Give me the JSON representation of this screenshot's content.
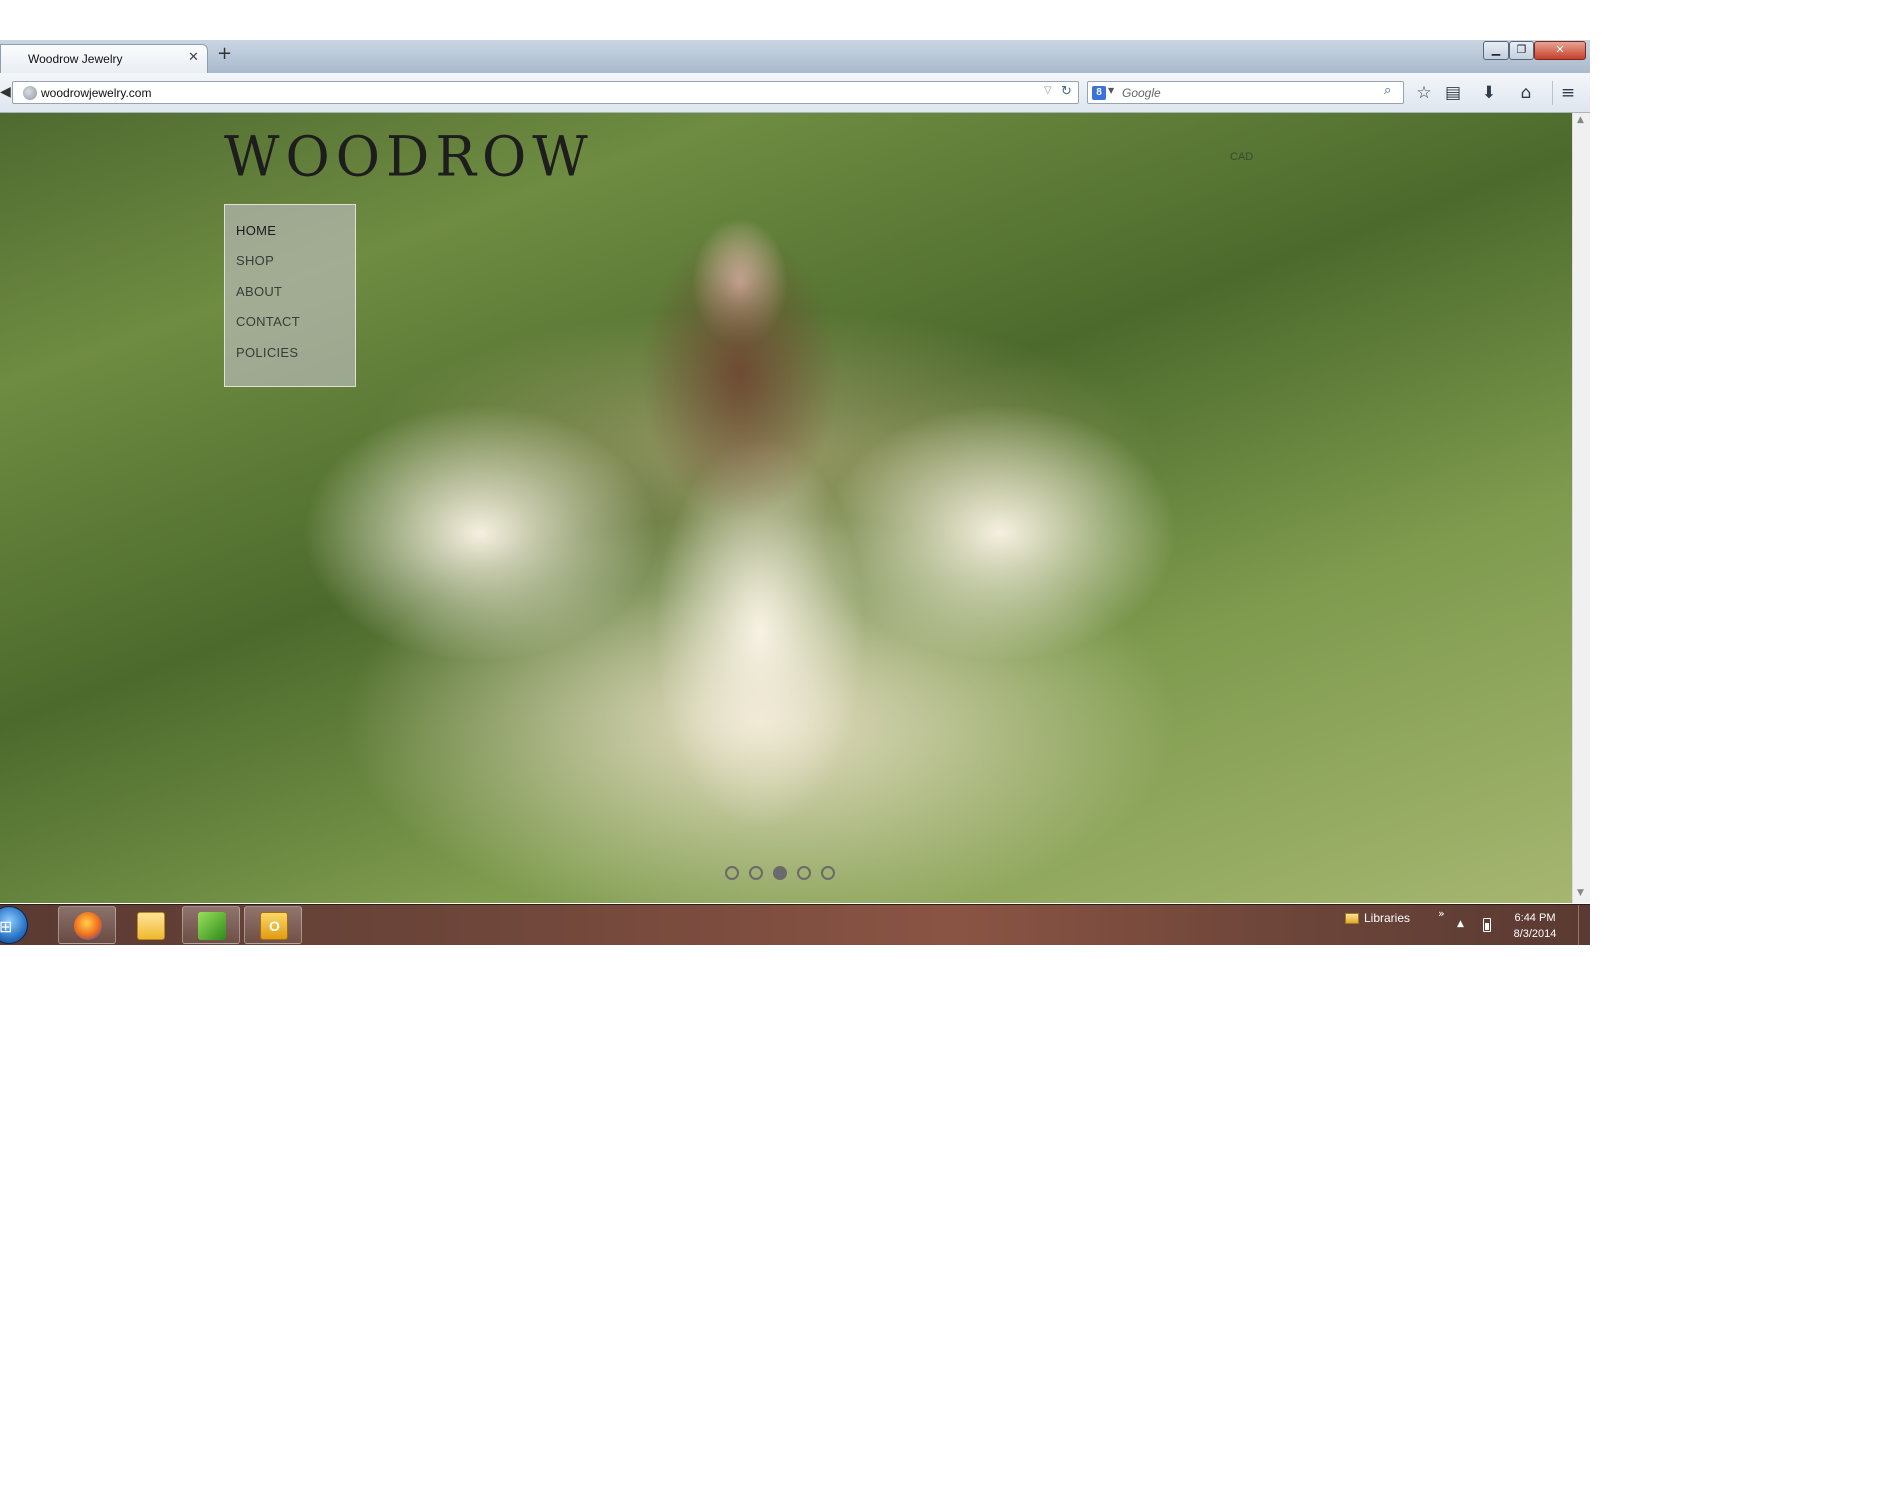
{
  "browser": {
    "tab": {
      "title": "Woodrow Jewelry",
      "close": "✕"
    },
    "new_tab": "+",
    "window_controls": {
      "minimize": "▁",
      "maximize": "❐",
      "close": "✕"
    },
    "url": "woodrowjewelry.com",
    "search": {
      "placeholder": "Google",
      "engine_icon": "8"
    },
    "icons": [
      "back-icon",
      "globe-icon",
      "dropdown-icon",
      "reload-icon",
      "search-icon",
      "star-icon",
      "bookmarks-list-icon",
      "download-icon",
      "home-icon",
      "menu-icon"
    ]
  },
  "site": {
    "logo": "WOODROW",
    "currency": "CAD",
    "nav": [
      "HOME",
      "SHOP",
      "ABOUT",
      "CONTACT",
      "POLICIES"
    ],
    "nav_active": "HOME",
    "slider": {
      "count": 5,
      "active_index": 2
    }
  },
  "taskbar": {
    "apps": [
      "firefox-icon",
      "folder-icon",
      "app-icon",
      "outlook-icon"
    ],
    "outlook_letter": "O",
    "toolbar_label": "Libraries",
    "chevron": "»",
    "tray_arrow": "▲",
    "time": "6:44 PM",
    "date": "8/3/2014"
  },
  "colors": {
    "taskbar": "#6e463a",
    "chrome": "#c9d5e3",
    "close_button": "#c6402b",
    "nav_panel": "#cdc8d7"
  }
}
